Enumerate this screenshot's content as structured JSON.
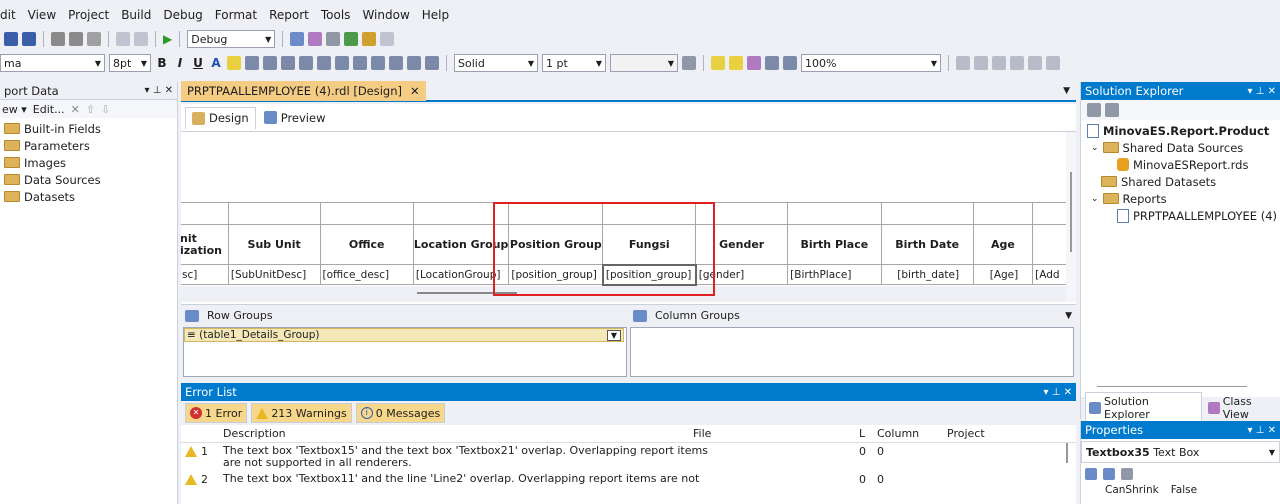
{
  "menu": [
    "dit",
    "View",
    "Project",
    "Build",
    "Debug",
    "Format",
    "Report",
    "Tools",
    "Window",
    "Help"
  ],
  "toolbar1": {
    "config": "Debug"
  },
  "toolbar2": {
    "font": "ma",
    "size": "8pt",
    "border_style": "Solid",
    "border_width": "1 pt",
    "zoom": "100%"
  },
  "report_data": {
    "title": "port Data",
    "toolbar": [
      "ew ▾",
      "Edit...",
      "✕",
      "⇧",
      "⇩"
    ],
    "items": [
      "Built-in Fields",
      "Parameters",
      "Images",
      "Data Sources",
      "Datasets"
    ]
  },
  "doc_tab": {
    "label": "PRPTPAALLEMPLOYEE (4).rdl [Design]",
    "close": "✕"
  },
  "view_tabs": {
    "design": "Design",
    "preview": "Preview"
  },
  "table": {
    "headers": [
      "nit\nization",
      "Sub Unit",
      "Office",
      "Location Group",
      "Position Group",
      "Fungsi",
      "Gender",
      "Birth Place",
      "Birth Date",
      "Age",
      ""
    ],
    "header_lines": [
      "nit",
      "ization"
    ],
    "cells": [
      "sc]",
      "[SubUnitDesc]",
      "[office_desc]",
      "[LocationGroup]",
      "[position_group]",
      "[position_group]",
      "[gender]",
      "[BirthPlace]",
      "[birth_date]",
      "[Age]",
      "[Add"
    ]
  },
  "groups": {
    "row_title": "Row Groups",
    "column_title": "Column Groups",
    "row_item": "(table1_Details_Group)"
  },
  "error_list": {
    "title": "Error List",
    "errors": "1 Error",
    "warnings": "213 Warnings",
    "messages": "0 Messages",
    "columns": [
      "Description",
      "File",
      "L",
      "Column",
      "Project"
    ],
    "rows": [
      {
        "num": "1",
        "desc1": "The text box 'Textbox15' and the text box 'Textbox21' overlap. Overlapping report items",
        "desc2": "are not supported in all renderers.",
        "l": "0",
        "col": "0"
      },
      {
        "num": "2",
        "desc1": "The text box 'Textbox11' and the line 'Line2' overlap. Overlapping report items are not",
        "desc2": "",
        "l": "0",
        "col": "0"
      }
    ]
  },
  "solution_explorer": {
    "title": "Solution Explorer",
    "project": "MinovaES.Report.Product",
    "items": [
      {
        "label": "Shared Data Sources",
        "indent": 1
      },
      {
        "label": "MinovaESReport.rds",
        "indent": 2
      },
      {
        "label": "Shared Datasets",
        "indent": 1
      },
      {
        "label": "Reports",
        "indent": 1
      },
      {
        "label": "PRPTPAALLEMPLOYEE (4)",
        "indent": 2
      }
    ],
    "tab_se": "Solution Explorer",
    "tab_cv": "Class View"
  },
  "properties": {
    "title": "Properties",
    "object": "Textbox35",
    "type": "Text Box",
    "prop_name": "CanShrink",
    "prop_value": "False"
  },
  "colors": {
    "highlight": "#e02020",
    "accent": "#007acc"
  }
}
